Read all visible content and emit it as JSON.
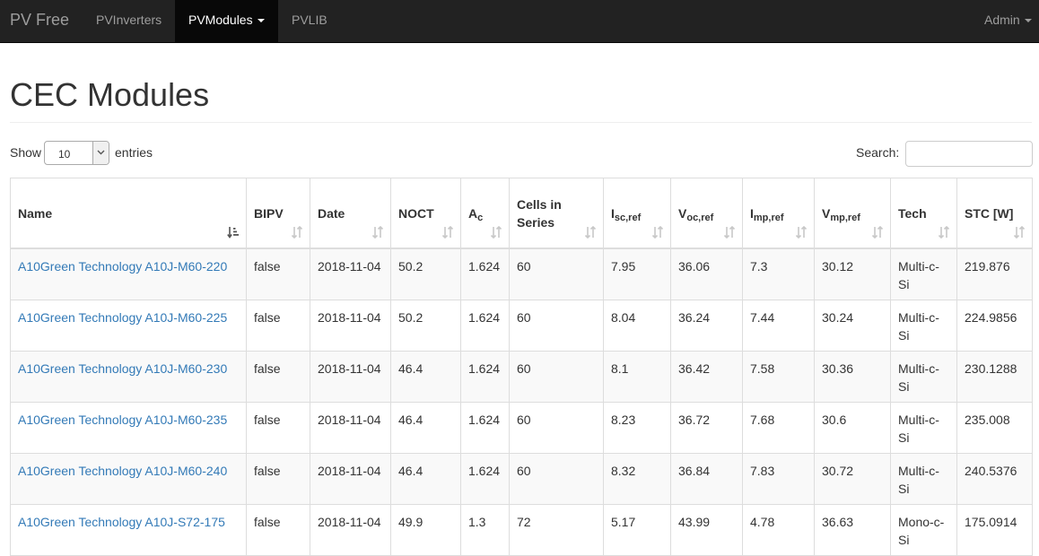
{
  "navbar": {
    "brand": "PV Free",
    "items": [
      {
        "label": "PVInverters"
      },
      {
        "label": "PVModules"
      },
      {
        "label": "PVLIB"
      }
    ],
    "admin": "Admin"
  },
  "page": {
    "title": "CEC Modules"
  },
  "controls": {
    "show_label": "Show",
    "page_length": "10",
    "entries_label": "entries",
    "search_label": "Search:",
    "search_value": ""
  },
  "table": {
    "columns": [
      {
        "label": "Name",
        "sort": "ascending"
      },
      {
        "label": "BIPV",
        "sort": "none"
      },
      {
        "label": "Date",
        "sort": "none"
      },
      {
        "label": "NOCT",
        "sort": "none"
      },
      {
        "label": "A",
        "sub": "c",
        "sort": "none"
      },
      {
        "label": "Cells in Series",
        "sort": "none"
      },
      {
        "label": "I",
        "sub": "sc,ref",
        "sort": "none"
      },
      {
        "label": "V",
        "sub": "oc,ref",
        "sort": "none"
      },
      {
        "label": "I",
        "sub": "mp,ref",
        "sort": "none"
      },
      {
        "label": "V",
        "sub": "mp,ref",
        "sort": "none"
      },
      {
        "label": "Tech",
        "sort": "none"
      },
      {
        "label": "STC [W]",
        "sort": "none"
      }
    ],
    "rows": [
      [
        "A10Green Technology A10J-M60-220",
        "false",
        "2018-11-04",
        "50.2",
        "1.624",
        "60",
        "7.95",
        "36.06",
        "7.3",
        "30.12",
        "Multi-c-Si",
        "219.876"
      ],
      [
        "A10Green Technology A10J-M60-225",
        "false",
        "2018-11-04",
        "50.2",
        "1.624",
        "60",
        "8.04",
        "36.24",
        "7.44",
        "30.24",
        "Multi-c-Si",
        "224.9856"
      ],
      [
        "A10Green Technology A10J-M60-230",
        "false",
        "2018-11-04",
        "46.4",
        "1.624",
        "60",
        "8.1",
        "36.42",
        "7.58",
        "30.36",
        "Multi-c-Si",
        "230.1288"
      ],
      [
        "A10Green Technology A10J-M60-235",
        "false",
        "2018-11-04",
        "46.4",
        "1.624",
        "60",
        "8.23",
        "36.72",
        "7.68",
        "30.6",
        "Multi-c-Si",
        "235.008"
      ],
      [
        "A10Green Technology A10J-M60-240",
        "false",
        "2018-11-04",
        "46.4",
        "1.624",
        "60",
        "8.32",
        "36.84",
        "7.83",
        "30.72",
        "Multi-c-Si",
        "240.5376"
      ],
      [
        "A10Green Technology A10J-S72-175",
        "false",
        "2018-11-04",
        "49.9",
        "1.3",
        "72",
        "5.17",
        "43.99",
        "4.78",
        "36.63",
        "Mono-c-Si",
        "175.0914"
      ]
    ]
  },
  "colors": {
    "navbar_bg": "#222222",
    "navbar_active_bg": "#080808",
    "link": "#337ab7"
  }
}
